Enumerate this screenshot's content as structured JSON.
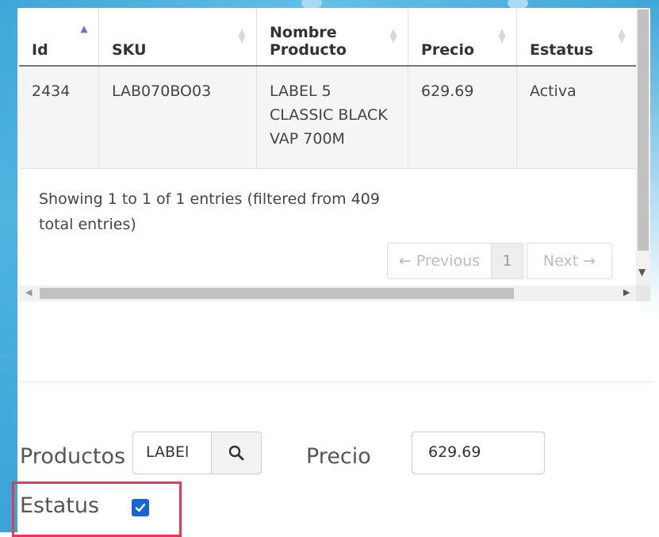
{
  "table": {
    "columns": [
      "Id",
      "SKU",
      "Nombre Producto",
      "Precio",
      "Estatus"
    ],
    "column_lines": [
      [
        "Id"
      ],
      [
        "SKU"
      ],
      [
        "Nombre",
        "Producto"
      ],
      [
        "Precio"
      ],
      [
        "Estatus"
      ]
    ],
    "rows": [
      {
        "id": "2434",
        "sku": "LAB070BO03",
        "nombre_lines": [
          "LABEL 5",
          "CLASSIC BLACK",
          "VAP 700M"
        ],
        "precio": "629.69",
        "estatus": "Activa"
      }
    ],
    "info_text": "Showing 1 to 1 of 1 entries (filtered from 409 total entries)",
    "pagination": {
      "previous": "← Previous",
      "page": "1",
      "next": "Next →"
    },
    "sorted_column": "Id",
    "sort_active_color": "#6f72c9"
  },
  "form": {
    "productos_label": "Productos",
    "productos_value": "LABEl",
    "precio_label": "Precio",
    "precio_value": "629.69",
    "estatus_label": "Estatus",
    "estatus_checked": true
  },
  "colors": {
    "highlight": "#e8375f",
    "checkbox": "#1565d8",
    "frame": "#3fa8d8"
  }
}
